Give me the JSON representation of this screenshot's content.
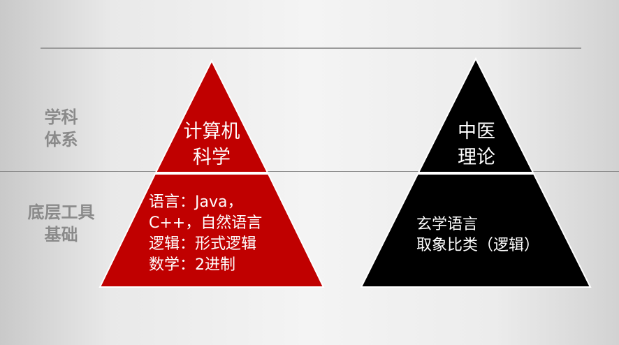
{
  "side_labels": {
    "top": [
      "学科",
      "体系"
    ],
    "bottom": [
      "底层工具",
      "基础"
    ]
  },
  "left_pyramid": {
    "top": [
      "计算机",
      "科学"
    ],
    "bottom": [
      "语言：Java，",
      "C++，自然语言",
      "逻辑：形式逻辑",
      "数学：2进制"
    ],
    "color": "#c00000"
  },
  "right_pyramid": {
    "top": [
      "中医",
      "理论"
    ],
    "bottom": [
      "玄学语言",
      "取象比类（逻辑）"
    ],
    "color": "#000000"
  }
}
